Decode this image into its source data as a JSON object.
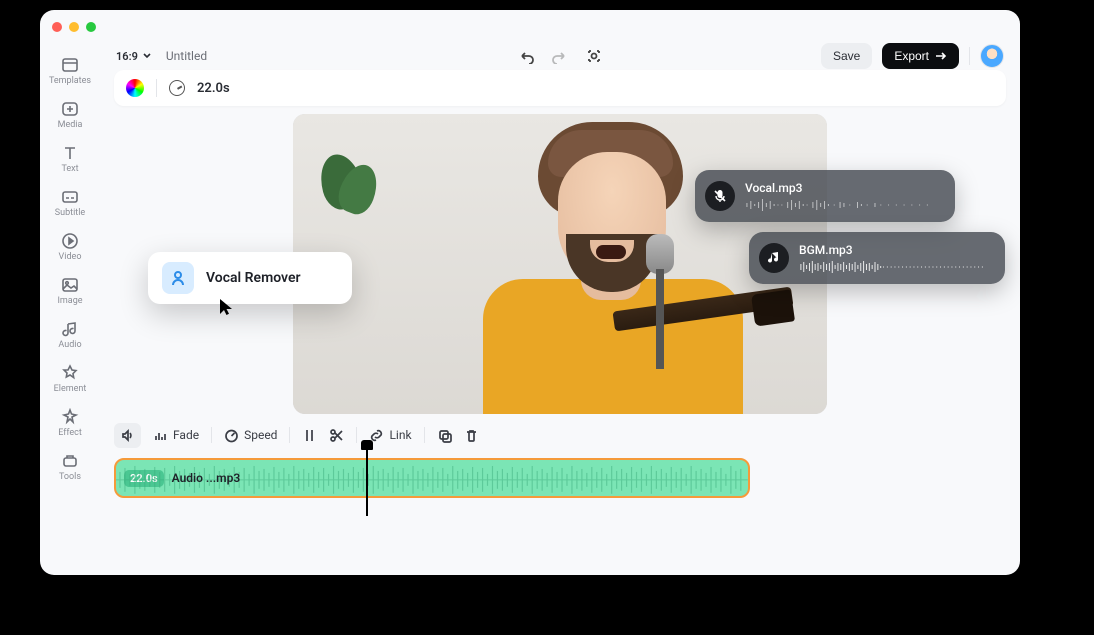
{
  "window": {
    "title": "Untitled",
    "ratio": "16:9"
  },
  "header": {
    "duration": "22.0s"
  },
  "sidebar": {
    "items": [
      {
        "label": "Templates"
      },
      {
        "label": "Media"
      },
      {
        "label": "Text"
      },
      {
        "label": "Subtitle"
      },
      {
        "label": "Video"
      },
      {
        "label": "Image"
      },
      {
        "label": "Audio"
      },
      {
        "label": "Element"
      },
      {
        "label": "Effect"
      },
      {
        "label": "Tools"
      }
    ]
  },
  "buttons": {
    "save": "Save",
    "export": "Export"
  },
  "popup": {
    "label": "Vocal Remover"
  },
  "audio_cards": {
    "vocal": "Vocal.mp3",
    "bgm": "BGM.mp3"
  },
  "toolbar2": {
    "fade": "Fade",
    "speed": "Speed",
    "link": "Link"
  },
  "clip": {
    "badge": "22.0s",
    "name": "Audio ...mp3"
  }
}
